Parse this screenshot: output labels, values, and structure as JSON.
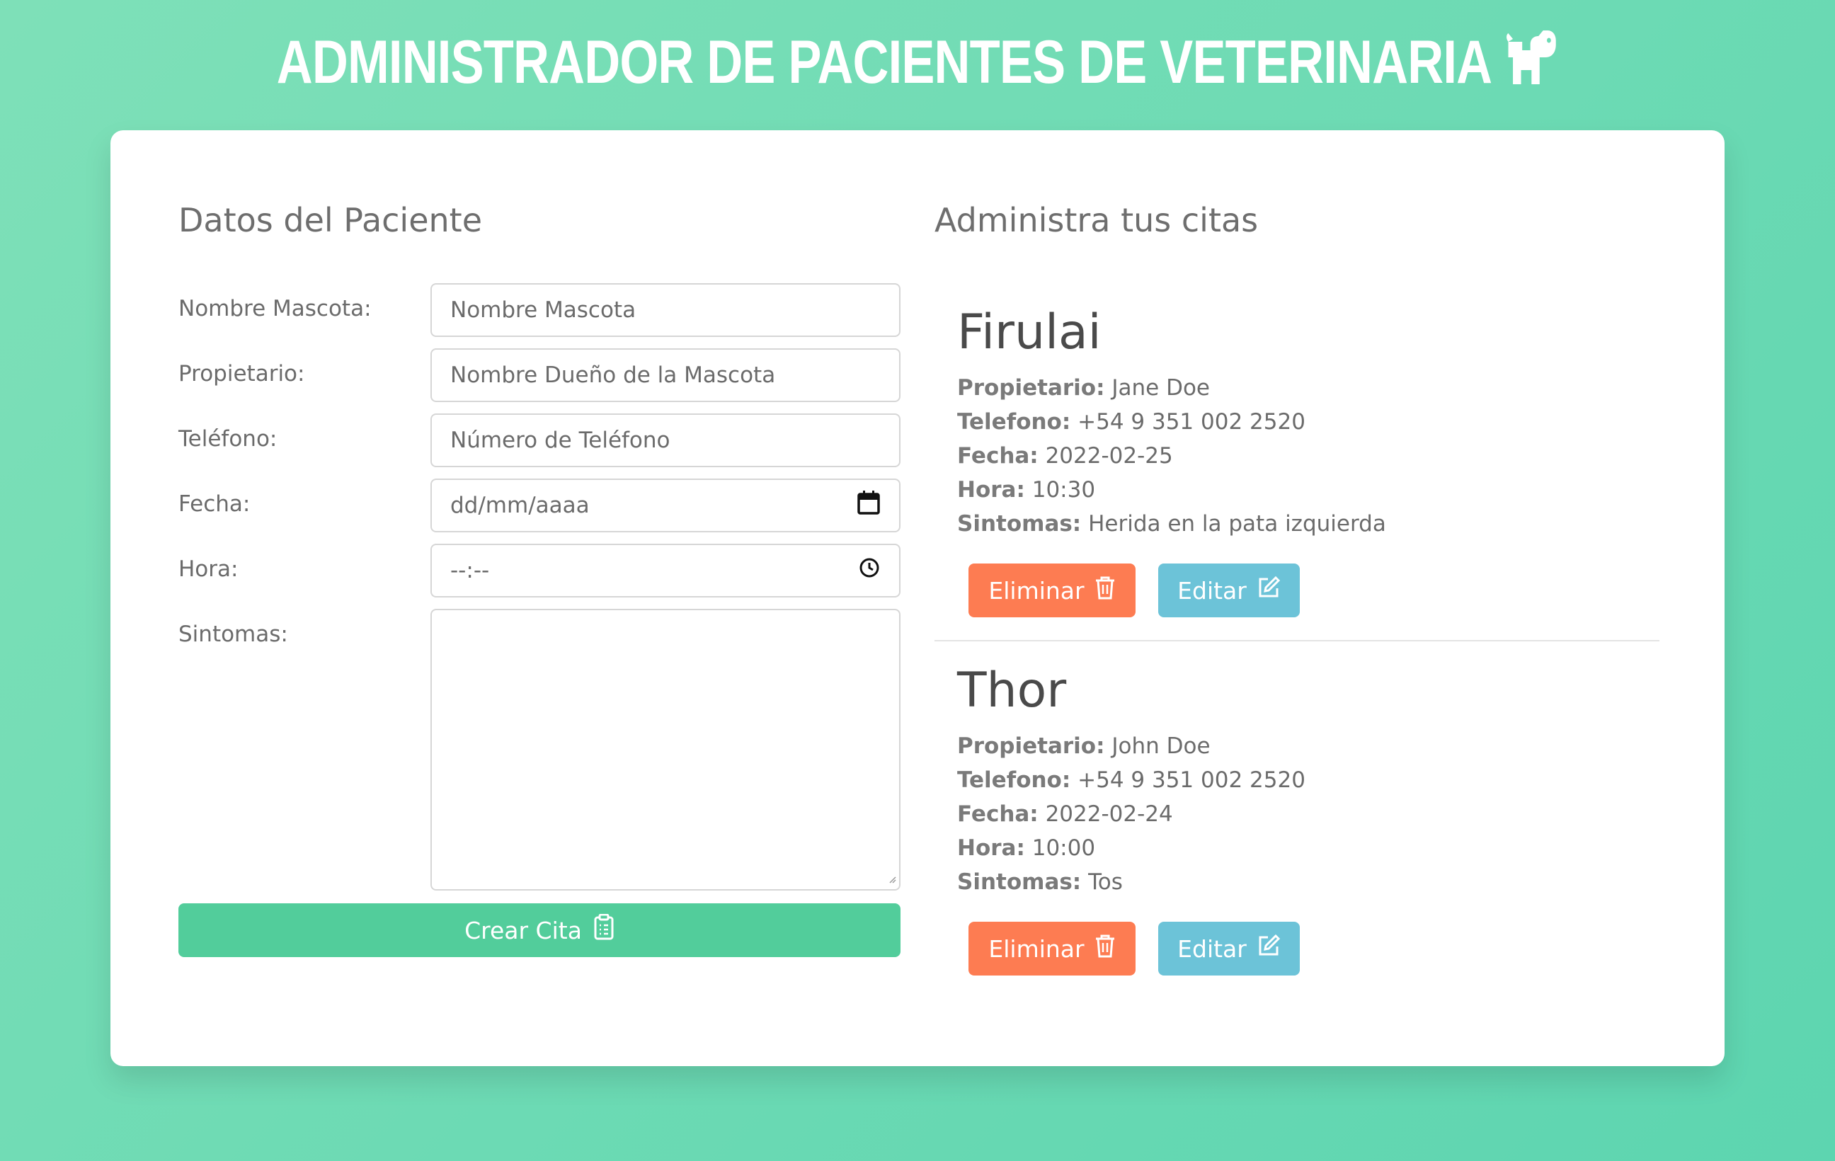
{
  "app": {
    "title": "ADMINISTRADOR DE PACIENTES DE VETERINARIA"
  },
  "form": {
    "title": "Datos del Paciente",
    "fields": [
      {
        "label": "Nombre Mascota:",
        "placeholder": "Nombre Mascota"
      },
      {
        "label": "Propietario:",
        "placeholder": "Nombre Dueño de la Mascota"
      },
      {
        "label": "Teléfono:",
        "placeholder": "Número de Teléfono"
      },
      {
        "label": "Fecha:",
        "placeholder": "dd/mm/aaaa"
      },
      {
        "label": "Hora:",
        "placeholder": "--:--"
      },
      {
        "label": "Sintomas:",
        "placeholder": ""
      }
    ],
    "submit_label": "Crear Cita"
  },
  "appointments": {
    "title": "Administra tus citas",
    "labels": {
      "owner": "Propietario:",
      "phone": "Telefono:",
      "date": "Fecha:",
      "time": "Hora:",
      "symptoms": "Sintomas:"
    },
    "delete_label": "Eliminar",
    "edit_label": "Editar",
    "items": [
      {
        "name": "Firulai",
        "owner": "Jane Doe",
        "phone": "+54 9 351 002 2520",
        "date": "2022-02-25",
        "time": "10:30",
        "symptoms": "Herida en la pata izquierda"
      },
      {
        "name": "Thor",
        "owner": "John Doe",
        "phone": "+54 9 351 002 2520",
        "date": "2022-02-24",
        "time": "10:00",
        "symptoms": "Tos"
      }
    ]
  },
  "colors": {
    "background": "#6cdcb5",
    "submit": "#52cd9b",
    "delete": "#fd7c52",
    "edit": "#6cc3d8"
  },
  "icons": [
    "dog-icon",
    "calendar-icon",
    "clock-icon",
    "clipboard-icon",
    "trash-icon",
    "edit-icon"
  ]
}
